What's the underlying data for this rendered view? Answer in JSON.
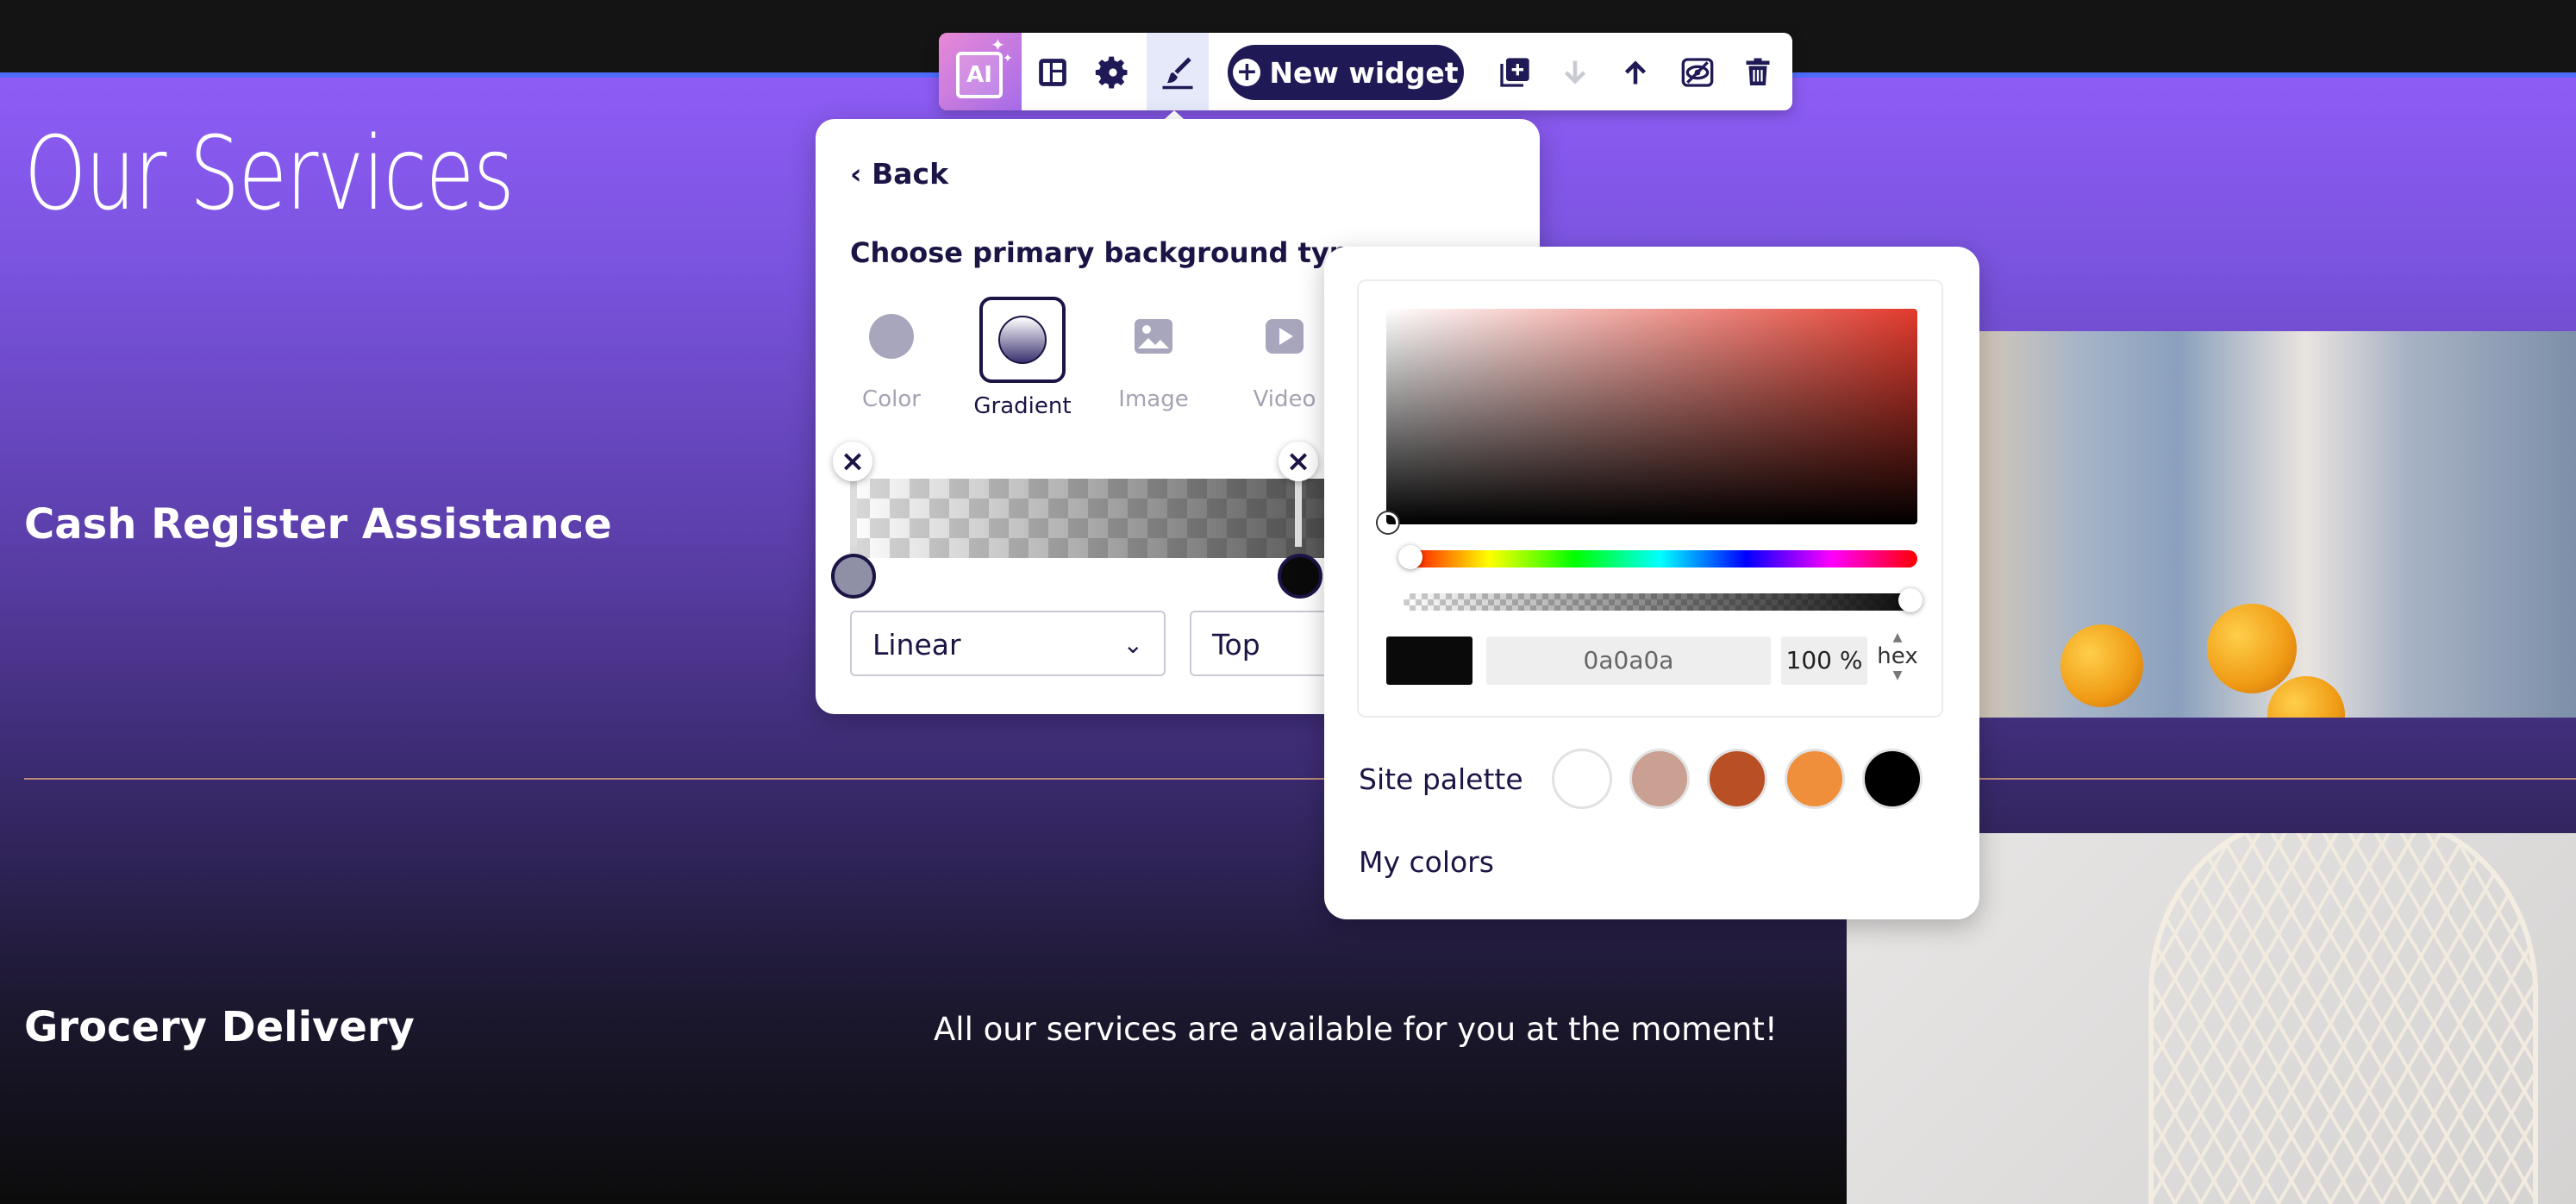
{
  "page": {
    "title": "Our Services",
    "services": [
      "Cash Register Assistance",
      "Grocery Delivery"
    ],
    "availability_text": "All our services are available for you at the moment!"
  },
  "toolbar": {
    "ai_label": "AI",
    "new_widget_label": "New widget",
    "icons": [
      "layout-icon",
      "settings-gear-icon",
      "brush-icon",
      "duplicate-icon",
      "move-down-icon",
      "move-up-icon",
      "hide-icon",
      "trash-icon"
    ]
  },
  "background_panel": {
    "back_label": "Back",
    "heading": "Choose primary background type:",
    "types": [
      {
        "label": "Color",
        "icon": "circle-icon",
        "selected": false
      },
      {
        "label": "Gradient",
        "icon": "gradient-icon",
        "selected": true
      },
      {
        "label": "Image",
        "icon": "image-icon",
        "selected": false
      },
      {
        "label": "Video",
        "icon": "video-icon",
        "selected": false
      }
    ],
    "gradient_type": "Linear",
    "gradient_direction": "Top"
  },
  "color_picker": {
    "hex_value": "0a0a0a",
    "opacity": "100 %",
    "format": "hex",
    "swatch_color": "#0a0a0a",
    "site_palette_label": "Site palette",
    "site_palette": [
      "#ffffff",
      "#c9a091",
      "#b84f25",
      "#ef8f3c",
      "#000000"
    ],
    "my_colors_label": "My colors"
  }
}
